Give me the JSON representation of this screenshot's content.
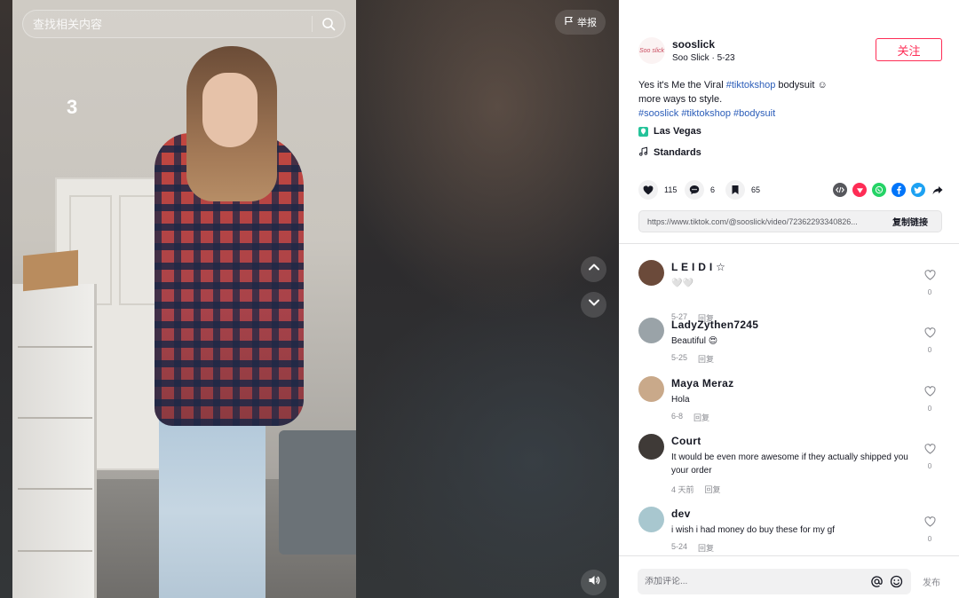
{
  "search": {
    "placeholder": "查找相关内容"
  },
  "video": {
    "report_label": "举报",
    "countdown": "3"
  },
  "author": {
    "username": "sooslick",
    "display_name": "Soo Slick",
    "separator": " · ",
    "date": "5-23",
    "follow_label": "关注",
    "avatar_text": "Soo slick"
  },
  "description": {
    "text_1": "Yes it's Me the Viral ",
    "tag_1": "#tiktokshop",
    "text_2": " bodysuit ☺︎",
    "text_3": "more ways to style.",
    "tags": [
      "#sooslick",
      "#tiktokshop",
      "#bodysuit"
    ]
  },
  "location": "Las Vegas",
  "music": "Standards",
  "stats": {
    "likes": "115",
    "comments": "6",
    "saves": "65"
  },
  "share": {
    "icons": [
      "embed-icon",
      "tiktok-friends-icon",
      "whatsapp-icon",
      "facebook-icon",
      "twitter-icon",
      "share-arrow-icon"
    ],
    "colors": {
      "embed": "#56575c",
      "friends": "#fe2c55",
      "whatsapp": "#25d366",
      "facebook": "#0075fa",
      "twitter": "#1da1f2"
    }
  },
  "link": {
    "url": "https://www.tiktok.com/@sooslick/video/72362293340826...",
    "copy_label": "复制链接"
  },
  "comments": [
    {
      "name": "L E I D I ☆",
      "text": "🤍🤍",
      "date": "5-27",
      "reply": "回复",
      "likes": "0",
      "avatar_color": "#6b4a3a"
    },
    {
      "name": "LadyZythen7245",
      "text": "Beautiful 😍",
      "date": "5-25",
      "reply": "回复",
      "likes": "0",
      "avatar_color": "#9aa3a8"
    },
    {
      "name": "Maya Meraz",
      "text": "Hola",
      "date": "6-8",
      "reply": "回复",
      "likes": "0",
      "avatar_color": "#c9a98a"
    },
    {
      "name": "Court",
      "text": "It would be even more awesome if they actually shipped you your order",
      "date": "4 天前",
      "reply": "回复",
      "likes": "0",
      "avatar_color": "#3f3a37"
    },
    {
      "name": "dev",
      "text": "i wish i had money do buy these for my gf",
      "date": "5-24",
      "reply": "回复",
      "likes": "0",
      "avatar_color": "#a8c7cf"
    }
  ],
  "composer": {
    "placeholder": "添加评论...",
    "post_label": "发布"
  }
}
